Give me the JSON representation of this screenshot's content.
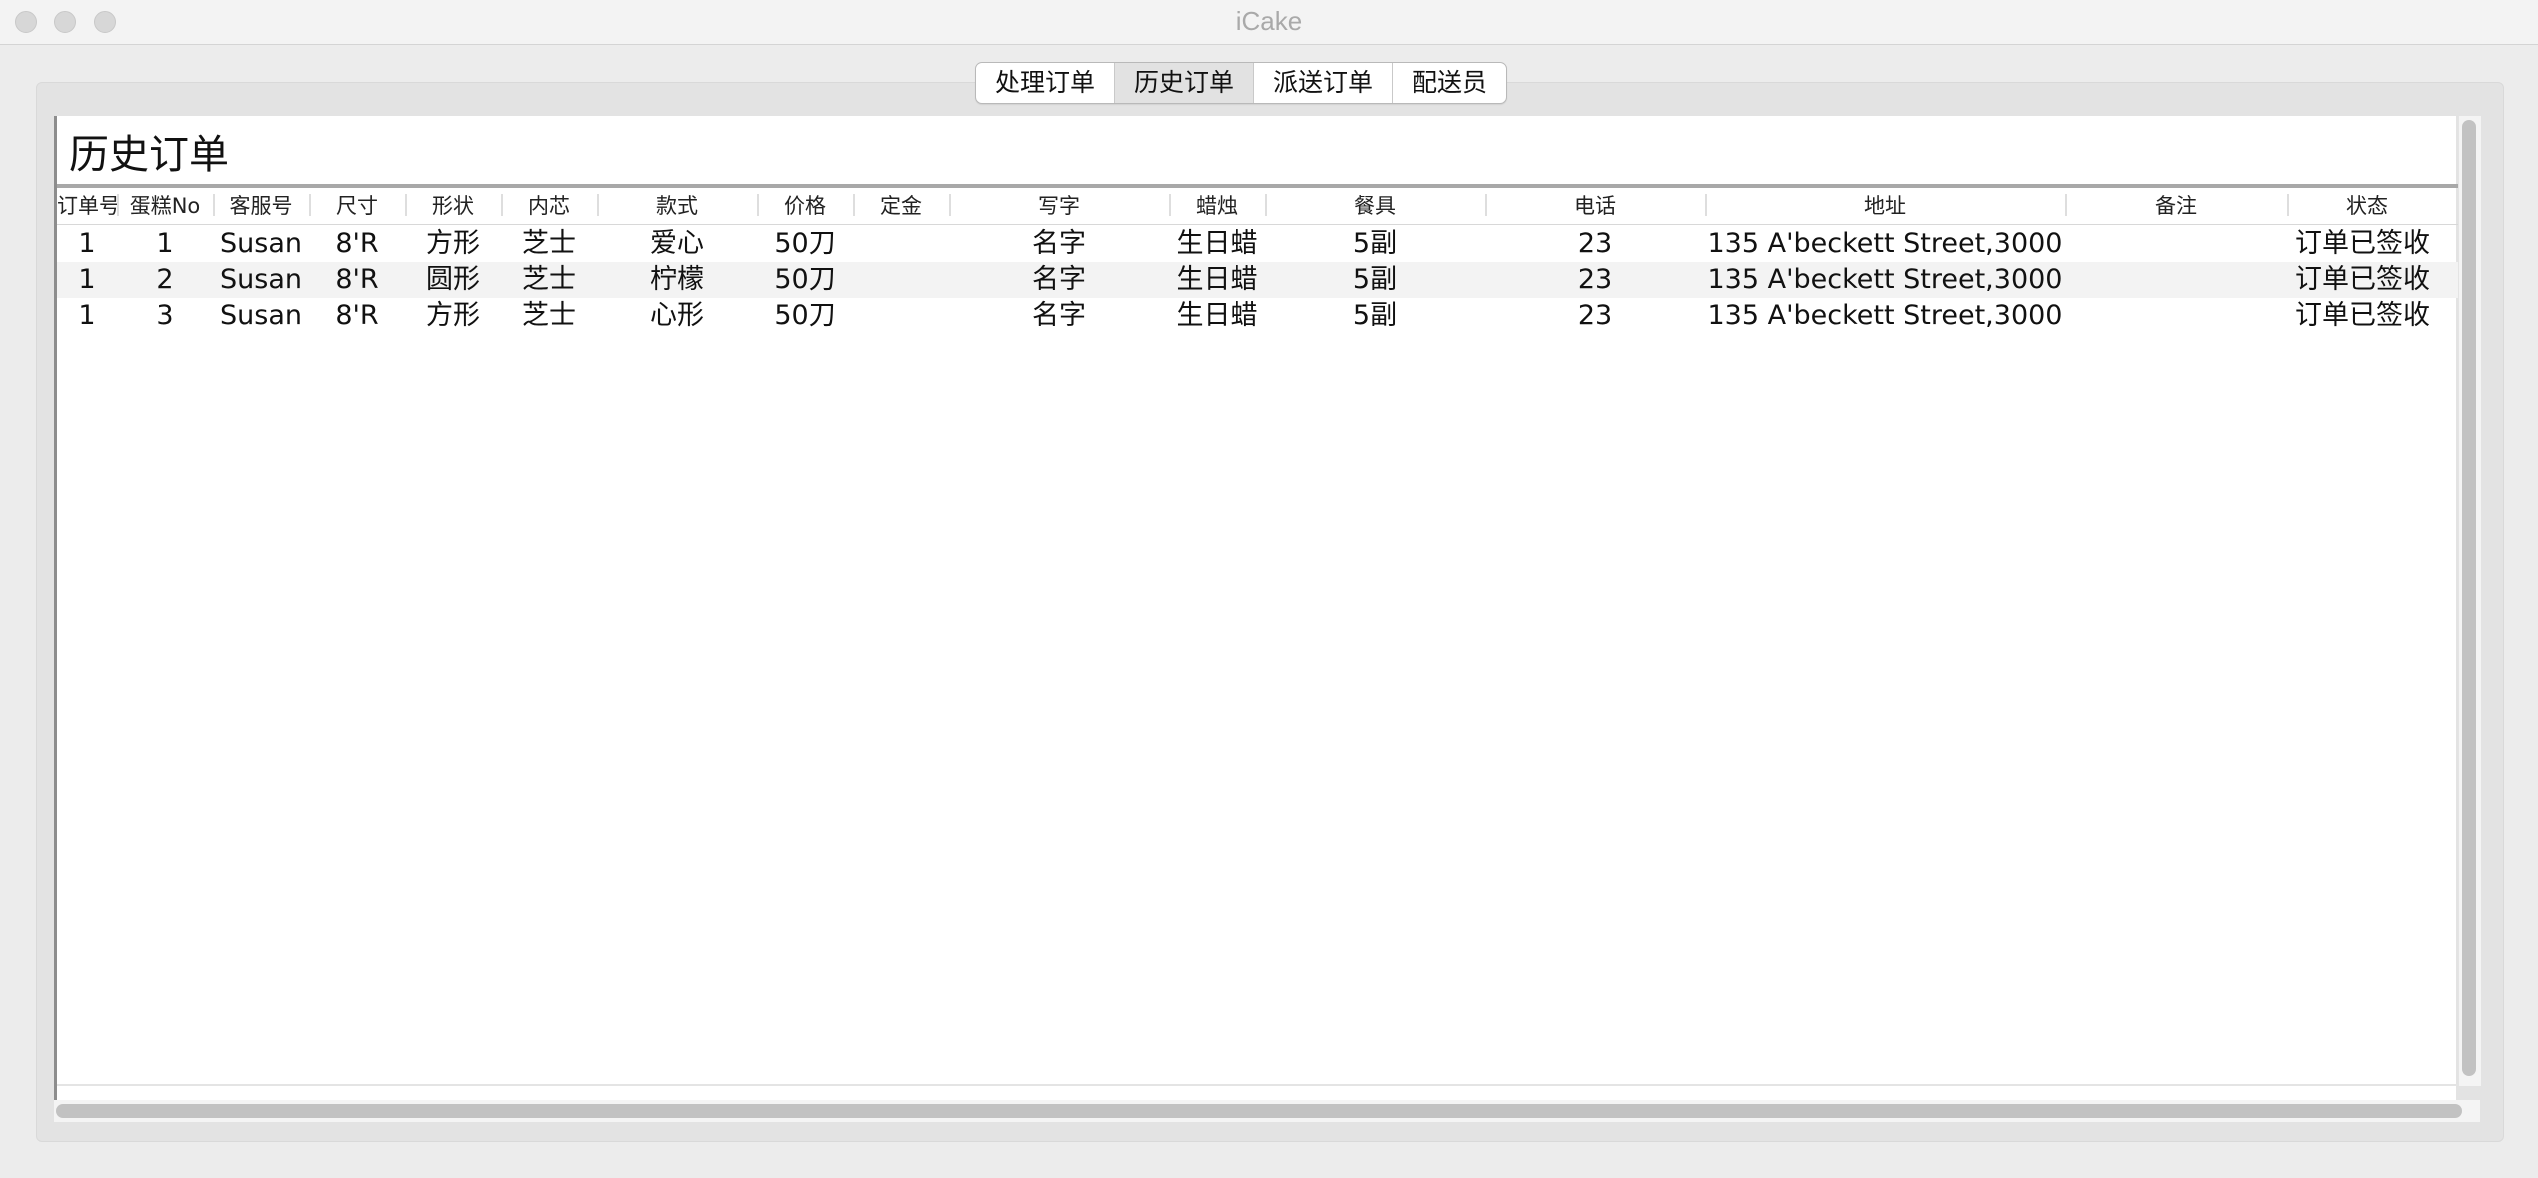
{
  "window": {
    "title": "iCake"
  },
  "tabs": [
    {
      "label": "处理订单",
      "selected": false
    },
    {
      "label": "历史订单",
      "selected": true
    },
    {
      "label": "派送订单",
      "selected": false
    },
    {
      "label": "配送员",
      "selected": false
    }
  ],
  "page": {
    "title": "历史订单"
  },
  "table": {
    "columns": [
      "订单号",
      "蛋糕No",
      "客服号",
      "尺寸",
      "形状",
      "内芯",
      "款式",
      "价格",
      "定金",
      "写字",
      "蜡烛",
      "餐具",
      "电话",
      "地址",
      "备注",
      "状态"
    ],
    "rows": [
      [
        "1",
        "1",
        "Susan",
        "8'R",
        "方形",
        "芝士",
        "爱心",
        "50刀",
        "",
        "名字",
        "生日蜡",
        "5副",
        "23",
        "135 A'beckett Street,3000",
        "",
        "订单已签收"
      ],
      [
        "1",
        "2",
        "Susan",
        "8'R",
        "圆形",
        "芝士",
        "柠檬",
        "50刀",
        "",
        "名字",
        "生日蜡",
        "5副",
        "23",
        "135 A'beckett Street,3000",
        "",
        "订单已签收"
      ],
      [
        "1",
        "3",
        "Susan",
        "8'R",
        "方形",
        "芝士",
        "心形",
        "50刀",
        "",
        "名字",
        "生日蜡",
        "5副",
        "23",
        "135 A'beckett Street,3000",
        "",
        "订单已签收"
      ]
    ]
  },
  "colors": {
    "window_bg": "#ececec",
    "selected_tab": "#e2e2e2",
    "alt_row": "#f3f3f3",
    "scroll_thumb": "#c2c2c2"
  }
}
